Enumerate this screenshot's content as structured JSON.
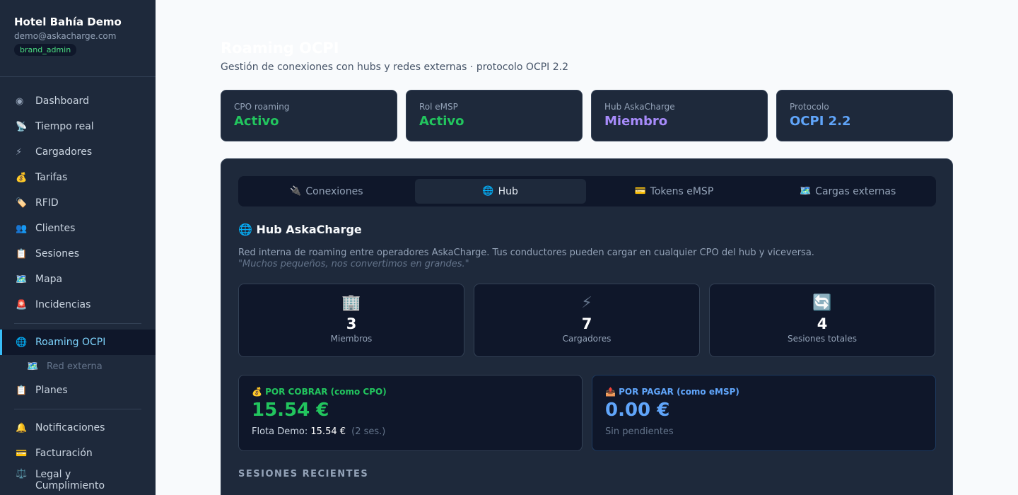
{
  "sidebar": {
    "org_name": "Hotel Bahía Demo",
    "email": "demo@askacharge.com",
    "role": "brand_admin",
    "items": [
      {
        "icon": "◉",
        "label": "Dashboard"
      },
      {
        "icon": "📡",
        "label": "Tiempo real"
      },
      {
        "icon": "⚡",
        "label": "Cargadores"
      },
      {
        "icon": "💰",
        "label": "Tarifas"
      },
      {
        "icon": "🏷️",
        "label": "RFID"
      },
      {
        "icon": "👥",
        "label": "Clientes"
      },
      {
        "icon": "📋",
        "label": "Sesiones"
      },
      {
        "icon": "🗺️",
        "label": "Mapa"
      },
      {
        "icon": "🚨",
        "label": "Incidencias"
      }
    ],
    "roaming": {
      "icon": "🌐",
      "label": "Roaming OCPI"
    },
    "roaming_sub": {
      "icon": "🗺️",
      "label": "Red externa"
    },
    "planes": {
      "icon": "📋",
      "label": "Planes"
    },
    "bottom": [
      {
        "icon": "🔔",
        "label": "Notificaciones"
      },
      {
        "icon": "💳",
        "label": "Facturación"
      },
      {
        "icon": "⚖️",
        "label": "Legal y\nCumplimiento"
      }
    ]
  },
  "page": {
    "title": "Roaming OCPI",
    "subtitle": "Gestión de conexiones con hubs y redes externas · protocolo OCPI 2.2"
  },
  "stats": [
    {
      "label": "CPO roaming",
      "value": "Activo",
      "color": "#22c55e"
    },
    {
      "label": "Rol eMSP",
      "value": "Activo",
      "color": "#22c55e"
    },
    {
      "label": "Hub AskaCharge",
      "value": "Miembro",
      "color": "#a78bfa"
    },
    {
      "label": "Protocolo",
      "value": "OCPI 2.2",
      "color": "#60a5fa"
    }
  ],
  "tabs": [
    {
      "icon": "🔌",
      "label": "Conexiones"
    },
    {
      "icon": "🌐",
      "label": "Hub"
    },
    {
      "icon": "💳",
      "label": "Tokens eMSP"
    },
    {
      "icon": "🗺️",
      "label": "Cargas externas"
    }
  ],
  "hub": {
    "icon": "🌐",
    "title": "Hub AskaCharge",
    "description": "Red interna de roaming entre operadores AskaCharge. Tus conductores pueden cargar en cualquier CPO del hub y viceversa.",
    "quote": "\"Muchos pequeños, nos convertimos en grandes.\"",
    "metrics": [
      {
        "icon": "🏢",
        "value": "3",
        "label": "Miembros"
      },
      {
        "icon": "⚡",
        "value": "7",
        "label": "Cargadores"
      },
      {
        "icon": "🔄",
        "value": "4",
        "label": "Sesiones totales"
      }
    ],
    "collect": {
      "icon": "💰",
      "title": "POR COBRAR (como CPO)",
      "amount": "15.54 €",
      "detail_name": "Flota Demo:",
      "detail_amount": "15.54 €",
      "detail_count": "(2 ses.)",
      "color": "#22c55e"
    },
    "pay": {
      "icon": "📤",
      "title": "POR PAGAR (como eMSP)",
      "amount": "0.00 €",
      "detail": "Sin pendientes",
      "color": "#60a5fa"
    },
    "recent_heading": "SESIONES RECIENTES"
  }
}
